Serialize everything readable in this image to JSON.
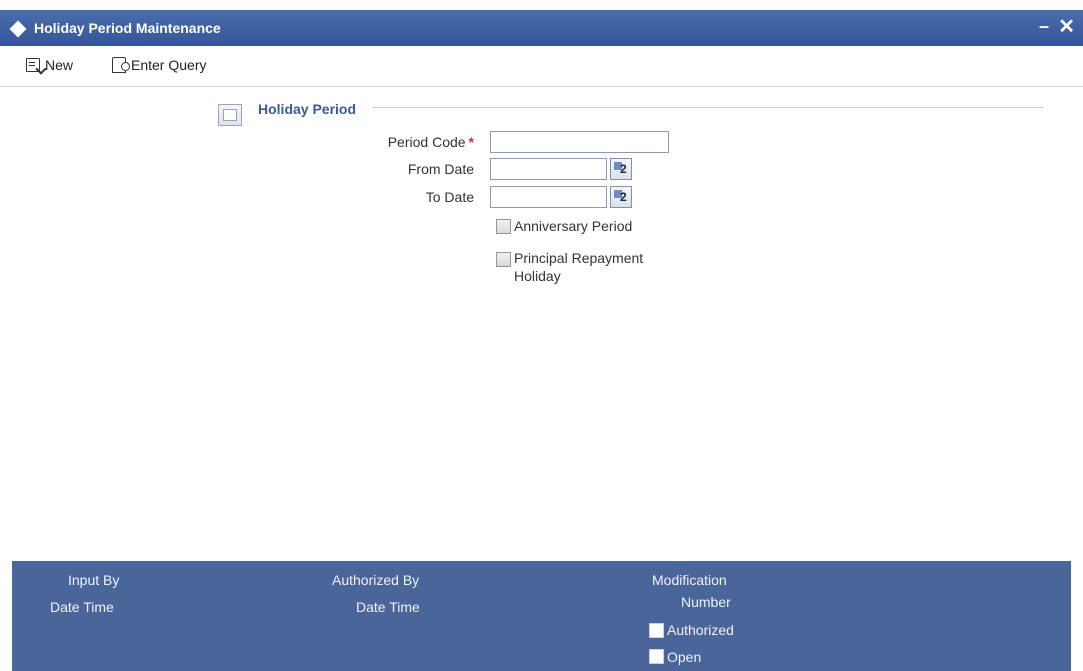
{
  "window": {
    "title": "Holiday Period Maintenance",
    "minimize": "–",
    "close": "✕"
  },
  "toolbar": {
    "new_label": "New",
    "enter_query_label": "Enter Query"
  },
  "section": {
    "title": "Holiday Period"
  },
  "form": {
    "period_code_label": "Period Code",
    "required_mark": "*",
    "period_code_value": "",
    "from_date_label": "From Date",
    "from_date_value": "",
    "to_date_label": "To Date",
    "to_date_value": "",
    "calendar_glyph": "2",
    "anniversary_label": "Anniversary Period",
    "anniversary_checked": false,
    "principal_label_line1": "Principal Repayment",
    "principal_label_line2": "Holiday",
    "principal_checked": false
  },
  "footer": {
    "input_by": "Input By",
    "input_date_time": "Date Time",
    "authorized_by": "Authorized By",
    "authorized_date_time": "Date Time",
    "modification_line1": "Modification",
    "modification_line2": "Number",
    "authorized_label": "Authorized",
    "open_label": "Open"
  },
  "colors": {
    "titlebar": "#3d5fa1",
    "footer": "#4a6599",
    "section_title": "#3a5a95",
    "required": "#dd3333"
  }
}
